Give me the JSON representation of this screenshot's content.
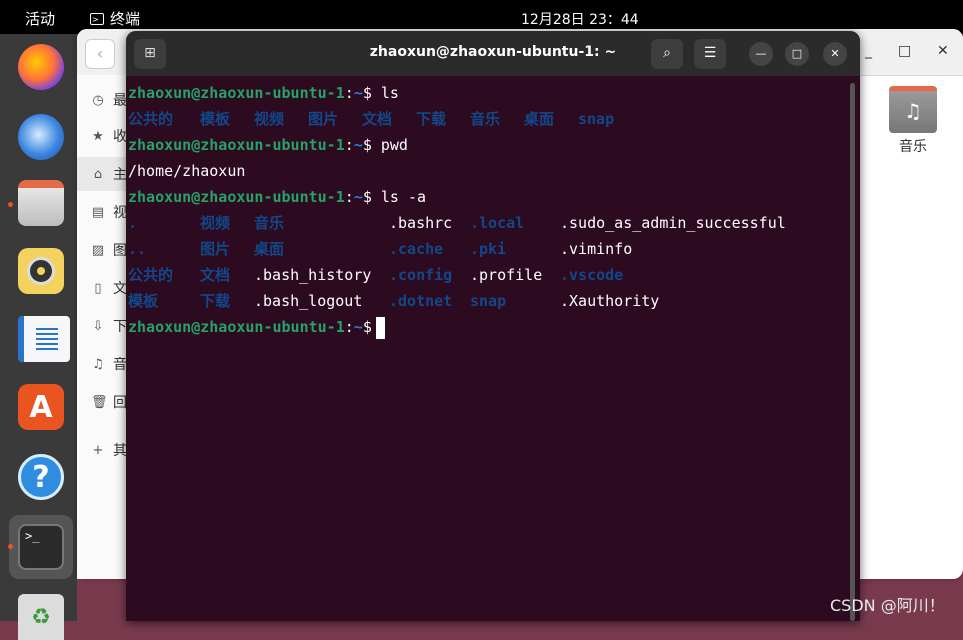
{
  "topbar": {
    "activities": "活动",
    "app_name": "终端",
    "clock": "12月28日  23：44"
  },
  "dock": {
    "items": [
      "firefox-icon",
      "thunderbird-icon",
      "files-icon",
      "rhythmbox-icon",
      "writer-icon",
      "app-center-icon",
      "help-icon",
      "terminal-icon",
      "trash-icon"
    ],
    "accent": "#e95420"
  },
  "files_window": {
    "sidebar": [
      "最",
      "收",
      "主",
      "视",
      "图",
      "文",
      "下",
      "音",
      "回",
      "其"
    ],
    "folder_label": "音乐"
  },
  "terminal": {
    "title": "zhaoxun@zhaoxun-ubuntu-1: ~",
    "prompt_user": "zhaoxun@zhaoxun-ubuntu-1",
    "prompt_path": "~",
    "cmd1": "ls",
    "ls_out": [
      "公共的",
      "模板",
      "视频",
      "图片",
      "文档",
      "下载",
      "音乐",
      "桌面",
      "snap"
    ],
    "cmd2": "pwd",
    "pwd_out": "/home/zhaoxun",
    "cmd3": "ls -a",
    "la_rows": [
      [
        ".",
        "视频",
        "音乐",
        ".bashrc",
        ".local",
        ".sudo_as_admin_successful"
      ],
      [
        "..",
        "图片",
        "桌面",
        ".cache",
        ".pki",
        ".viminfo"
      ],
      [
        "公共的",
        "文档",
        ".bash_history",
        ".config",
        ".profile",
        ".vscode"
      ],
      [
        "模板",
        "下载",
        ".bash_logout",
        ".dotnet",
        "snap",
        ".Xauthority"
      ]
    ],
    "colors": {
      "background": "#2c0a1f",
      "user": "#26a269",
      "dir": "#12488b"
    }
  },
  "watermark": "CSDN @阿川！"
}
